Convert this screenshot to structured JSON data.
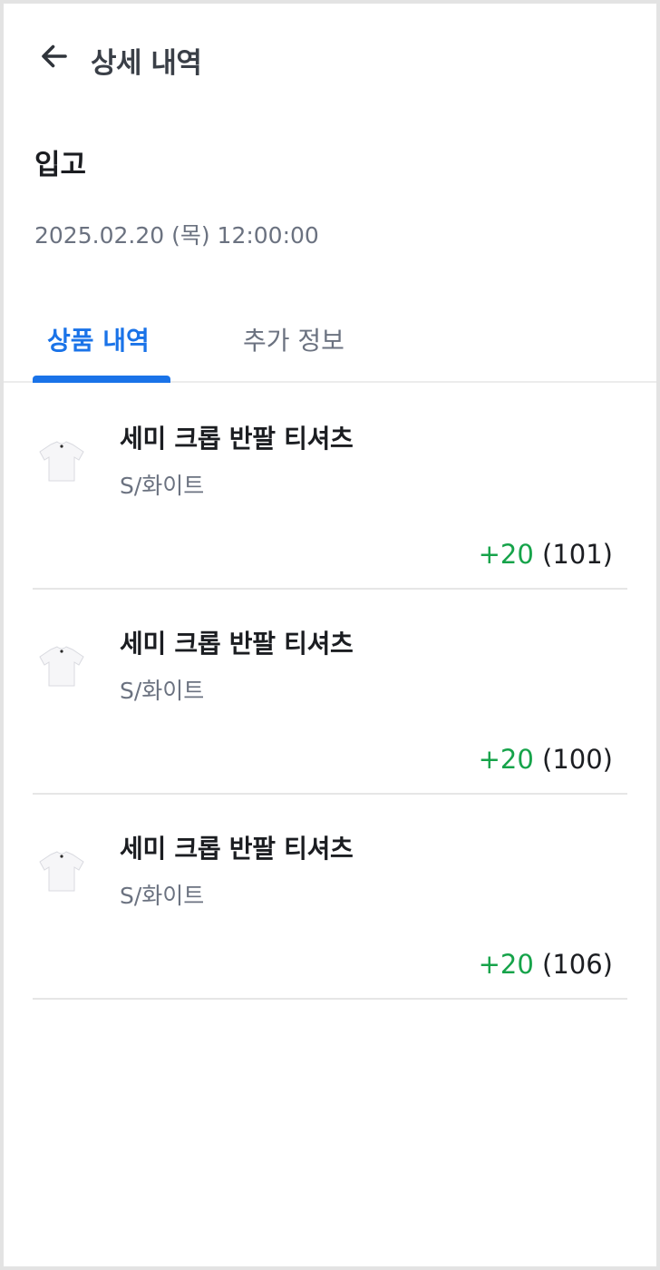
{
  "header": {
    "back_icon": "arrow-left-icon",
    "title": "상세 내역"
  },
  "summary": {
    "type": "입고",
    "datetime": "2025.02.20 (목) 12:00:00"
  },
  "tabs": [
    {
      "label": "상품 내역",
      "active": true
    },
    {
      "label": "추가 정보",
      "active": false
    }
  ],
  "items": [
    {
      "thumbnail_icon": "tshirt-icon",
      "name": "세미 크롭 반팔 티셔츠",
      "option": "S/화이트",
      "delta": "+20",
      "total": "(101)"
    },
    {
      "thumbnail_icon": "tshirt-icon",
      "name": "세미 크롭 반팔 티셔츠",
      "option": "S/화이트",
      "delta": "+20",
      "total": "(100)"
    },
    {
      "thumbnail_icon": "tshirt-icon",
      "name": "세미 크롭 반팔 티셔츠",
      "option": "S/화이트",
      "delta": "+20",
      "total": "(106)"
    }
  ],
  "colors": {
    "accent": "#1a73e8",
    "positive": "#16a34a"
  }
}
